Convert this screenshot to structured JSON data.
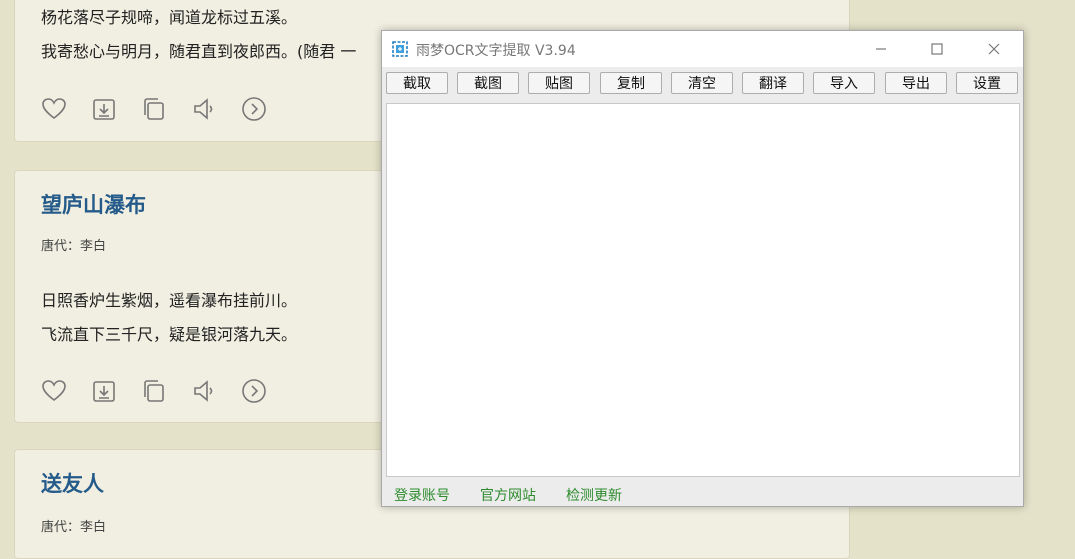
{
  "poems": [
    {
      "lines": [
        "杨花落尽子规啼，闻道龙标过五溪。",
        "我寄愁心与明月，随君直到夜郎西。(随君 一"
      ]
    },
    {
      "title": "望庐山瀑布",
      "author": "唐代：李白",
      "lines": [
        "日照香炉生紫烟，遥看瀑布挂前川。",
        "飞流直下三千尺，疑是银河落九天。"
      ]
    },
    {
      "title": "送友人",
      "author": "唐代：李白"
    }
  ],
  "ocr_window": {
    "title": "雨梦OCR文字提取 V3.94",
    "toolbar": [
      "截取",
      "截图",
      "贴图",
      "复制",
      "清空",
      "翻译",
      "导入",
      "导出",
      "设置"
    ],
    "text_content": "",
    "footer": [
      "登录账号",
      "官方网站",
      "检测更新"
    ]
  },
  "colors": {
    "page_bg": "#e4e2c9",
    "card_bg": "#f1efe1",
    "title": "#245b8a",
    "footer_link": "#2e8b2e"
  }
}
